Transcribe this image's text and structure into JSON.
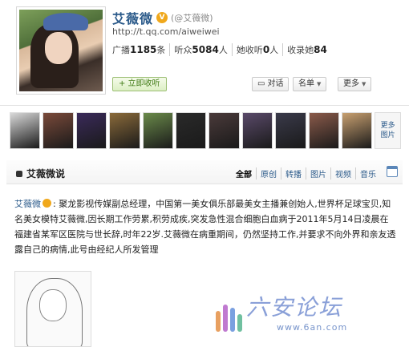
{
  "profile": {
    "name": "艾薇微",
    "vip_badge": "V",
    "handle": "(@艾薇微)",
    "url": "http://t.qq.com/aiweiwei",
    "stats": [
      {
        "label": "广播",
        "value": "1185",
        "unit": "条"
      },
      {
        "label": "听众",
        "value": "5084",
        "unit": "人"
      },
      {
        "label": "她收听",
        "value": "0",
        "unit": "人"
      },
      {
        "label": "收录她",
        "value": "84",
        "unit": ""
      }
    ],
    "follow_label": "+ 立即收听",
    "chat_label": "对话",
    "list_label": "名单",
    "more_label": "更多"
  },
  "gallery": {
    "more_label_1": "更多",
    "more_label_2": "图片",
    "thumb_colors": [
      "#d9d9d9",
      "#7a4a3a",
      "#3a2a5a",
      "#8a6a3a",
      "#6a8a4a",
      "#2a2a2a",
      "#4a3a3a",
      "#5a4a6a",
      "#3a3a4a",
      "#8a5a4a",
      "#c8a070"
    ]
  },
  "feed": {
    "title": "艾薇微说",
    "tabs": [
      "全部",
      "原创",
      "转播",
      "图片",
      "视频",
      "音乐"
    ],
    "active_tab": "全部"
  },
  "post": {
    "author": "艾薇微",
    "text": ": 聚龙影视传媒副总经理，中国第一美女俱乐部最美女主播兼创始人,世界杯足球宝贝,知名美女模特艾薇微,因长期工作劳累,积劳成疾,突发急性混合细胞白血病于2011年5月14日凌晨在福建省某军区医院与世长辞,时年22岁.艾薇微在病重期间，仍然坚持工作,并要求不向外界和亲友透露自己的病情,此号由经纪人所发管理"
  },
  "watermark": {
    "title": "六安论坛",
    "url": "www.6an.com",
    "colors": [
      "#e8a060",
      "#c07ad0",
      "#7aa0e0",
      "#70c0a0"
    ]
  }
}
